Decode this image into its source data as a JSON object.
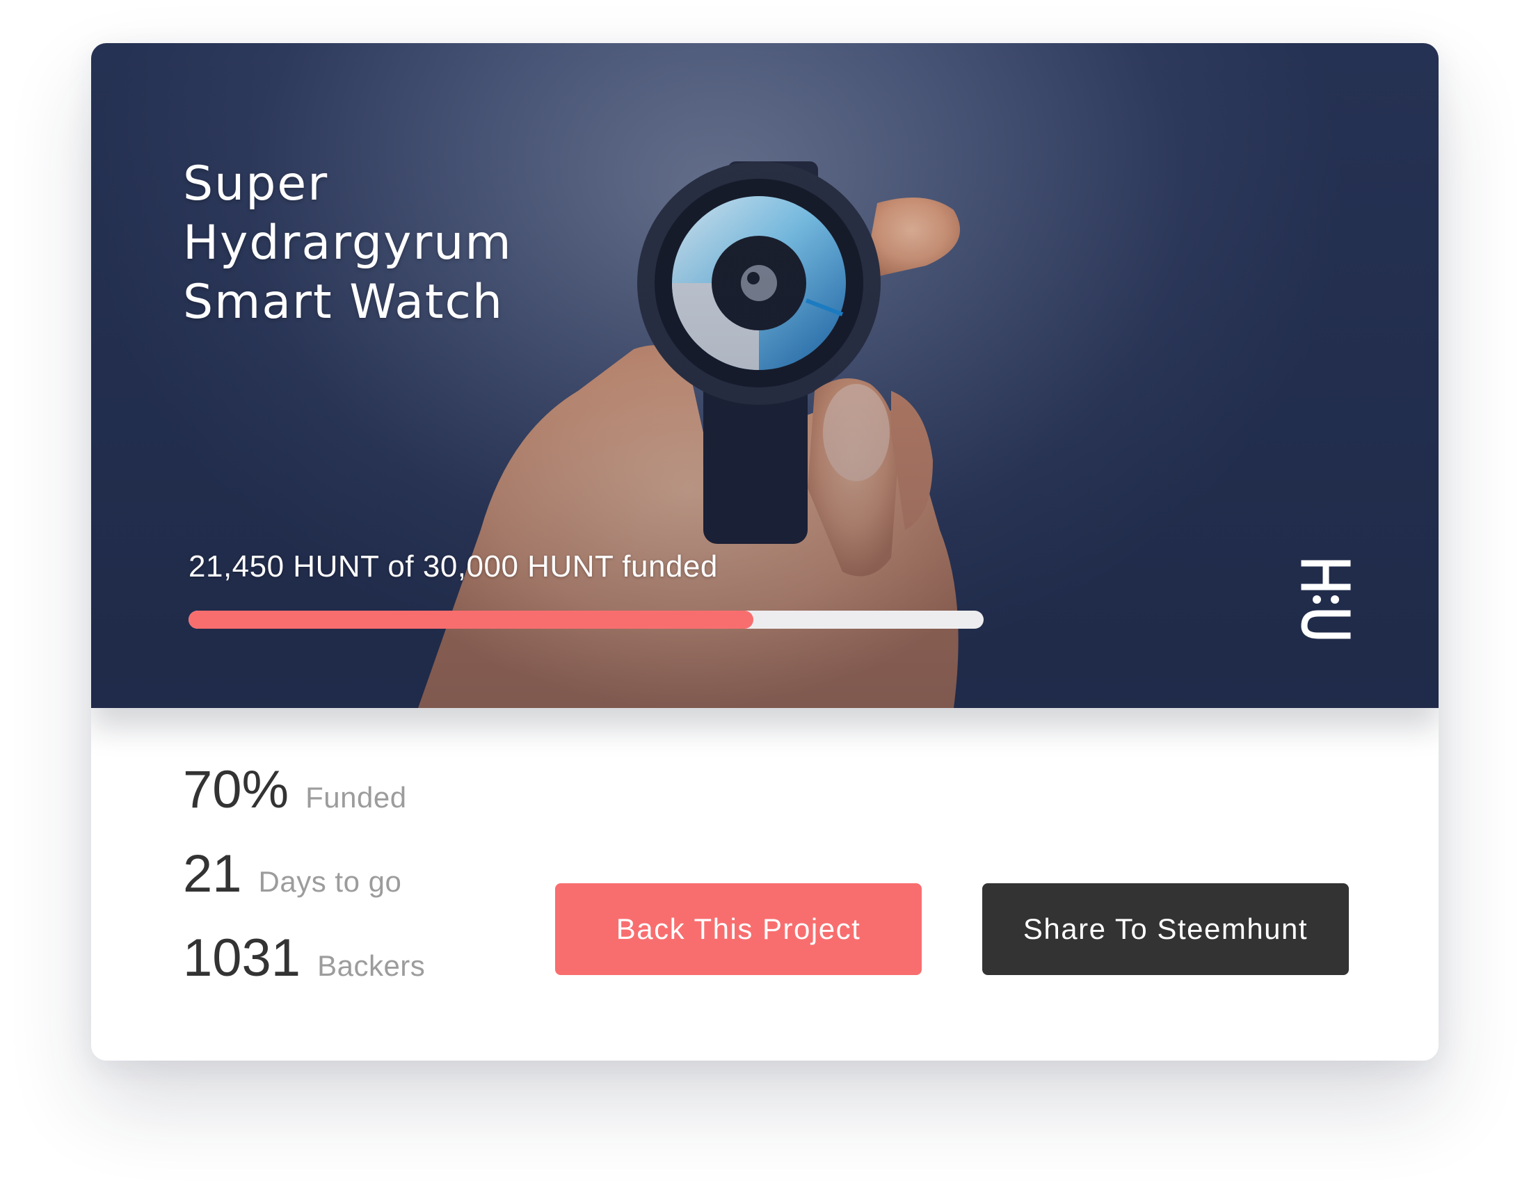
{
  "project": {
    "title": "Super\nHydrargyrum\nSmart Watch",
    "funding_label": "21,450 HUNT of 30,000 HUNT funded",
    "funded_fraction": 0.71
  },
  "stats": {
    "funded": {
      "value": "70%",
      "label": "Funded"
    },
    "days": {
      "value": "21",
      "label": "Days to go"
    },
    "backers": {
      "value": "1031",
      "label": "Backers"
    }
  },
  "actions": {
    "back_label": "Back This Project",
    "share_label": "Share To Steemhunt"
  },
  "colors": {
    "accent": "#f86e6f",
    "dark_button": "#333333",
    "track": "#ededef"
  },
  "icons": {
    "brand": "steemhunt-logo-icon"
  }
}
